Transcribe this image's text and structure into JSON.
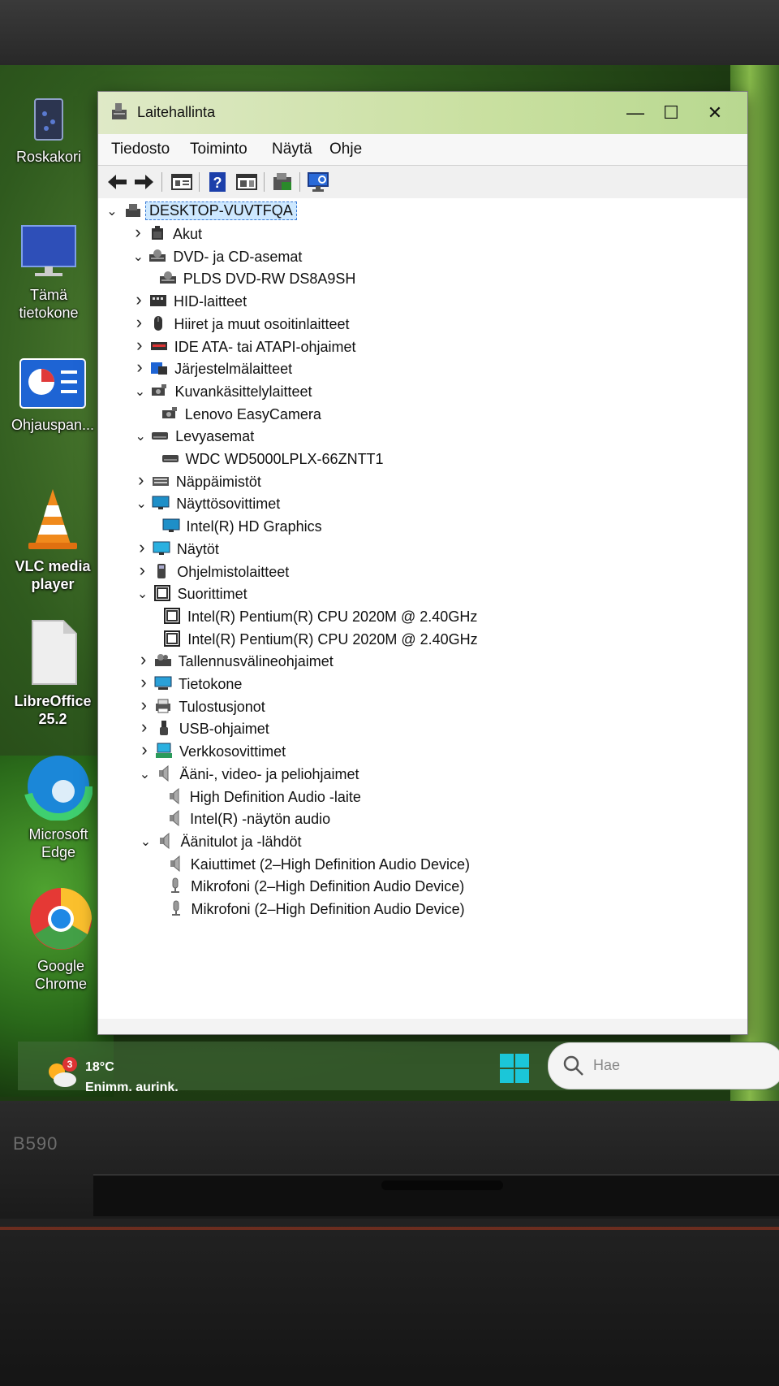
{
  "desktop": {
    "icons": [
      {
        "label": "Roskakori"
      },
      {
        "label": "Tämä\ntietokone"
      },
      {
        "label": "Ohjauspan..."
      },
      {
        "label": "VLC media\nplayer"
      },
      {
        "label": "LibreOffice\n25.2"
      },
      {
        "label": "Microsoft\nEdge"
      },
      {
        "label": "Google\nChrome"
      }
    ]
  },
  "window": {
    "title": "Laitehallinta",
    "controls": {
      "minimize": "—",
      "maximize": "☐",
      "close": "✕"
    },
    "menu": [
      "Tiedosto",
      "Toiminto",
      "Näytä",
      "Ohje"
    ]
  },
  "tree": {
    "root": "DESKTOP-VUVTFQA",
    "rows": [
      {
        "label": "Akut",
        "expanded": false,
        "level": 1,
        "icon": "battery-icon"
      },
      {
        "label": "DVD- ja CD-asemat",
        "expanded": true,
        "level": 1,
        "icon": "dvd-drive-icon"
      },
      {
        "label": "PLDS DVD-RW DS8A9SH",
        "level": 2,
        "icon": "dvd-drive-icon"
      },
      {
        "label": "HID-laitteet",
        "expanded": false,
        "level": 1,
        "icon": "hid-icon"
      },
      {
        "label": "Hiiret ja muut osoitinlaitteet",
        "expanded": false,
        "level": 1,
        "icon": "mouse-icon"
      },
      {
        "label": "IDE ATA- tai ATAPI-ohjaimet",
        "expanded": false,
        "level": 1,
        "icon": "ide-controller-icon"
      },
      {
        "label": "Järjestelmälaitteet",
        "expanded": false,
        "level": 1,
        "icon": "system-device-icon"
      },
      {
        "label": "Kuvankäsittelylaitteet",
        "expanded": true,
        "level": 1,
        "icon": "camera-icon"
      },
      {
        "label": "Lenovo EasyCamera",
        "level": 2,
        "icon": "camera-icon"
      },
      {
        "label": "Levyasemat",
        "expanded": true,
        "level": 1,
        "icon": "disk-drive-icon"
      },
      {
        "label": "WDC WD5000LPLX-66ZNTT1",
        "level": 2,
        "icon": "disk-drive-icon"
      },
      {
        "label": "Näppäimistöt",
        "expanded": false,
        "level": 1,
        "icon": "keyboard-icon"
      },
      {
        "label": "Näyttösovittimet",
        "expanded": true,
        "level": 1,
        "icon": "display-adapter-icon"
      },
      {
        "label": "Intel(R) HD Graphics",
        "level": 2,
        "icon": "display-adapter-icon"
      },
      {
        "label": "Näytöt",
        "expanded": false,
        "level": 1,
        "icon": "monitor-icon"
      },
      {
        "label": "Ohjelmistolaitteet",
        "expanded": false,
        "level": 1,
        "icon": "software-device-icon"
      },
      {
        "label": "Suorittimet",
        "expanded": true,
        "level": 1,
        "icon": "cpu-icon"
      },
      {
        "label": "Intel(R) Pentium(R) CPU 2020M @ 2.40GHz",
        "level": 2,
        "icon": "cpu-icon"
      },
      {
        "label": "Intel(R) Pentium(R) CPU 2020M @ 2.40GHz",
        "level": 2,
        "icon": "cpu-icon"
      },
      {
        "label": "Tallennusvälineohjaimet",
        "expanded": false,
        "level": 1,
        "icon": "storage-controller-icon"
      },
      {
        "label": "Tietokone",
        "expanded": false,
        "level": 1,
        "icon": "computer-icon"
      },
      {
        "label": "Tulostusjonot",
        "expanded": false,
        "level": 1,
        "icon": "printer-icon"
      },
      {
        "label": "USB-ohjaimet",
        "expanded": false,
        "level": 1,
        "icon": "usb-icon"
      },
      {
        "label": "Verkkosovittimet",
        "expanded": false,
        "level": 1,
        "icon": "network-adapter-icon"
      },
      {
        "label": "Ääni-, video- ja peliohjaimet",
        "expanded": true,
        "level": 1,
        "icon": "speaker-icon"
      },
      {
        "label": "High Definition Audio -laite",
        "level": 2,
        "icon": "speaker-icon"
      },
      {
        "label": "Intel(R) -näytön audio",
        "level": 2,
        "icon": "speaker-icon"
      },
      {
        "label": "Äänitulot ja -lähdöt",
        "expanded": true,
        "level": 1,
        "icon": "speaker-icon"
      },
      {
        "label": "Kaiuttimet (2–High Definition Audio Device)",
        "level": 2,
        "icon": "speaker-icon"
      },
      {
        "label": "Mikrofoni (2–High Definition Audio Device)",
        "level": 2,
        "icon": "microphone-icon"
      },
      {
        "label": "Mikrofoni (2–High Definition Audio Device)",
        "level": 2,
        "icon": "microphone-icon"
      }
    ]
  },
  "taskbar": {
    "weather_temp": "18°C",
    "weather_text": "Enimm. aurink.",
    "weather_badge": "3",
    "search_placeholder": "Hae"
  },
  "laptop": {
    "model": "B590"
  }
}
